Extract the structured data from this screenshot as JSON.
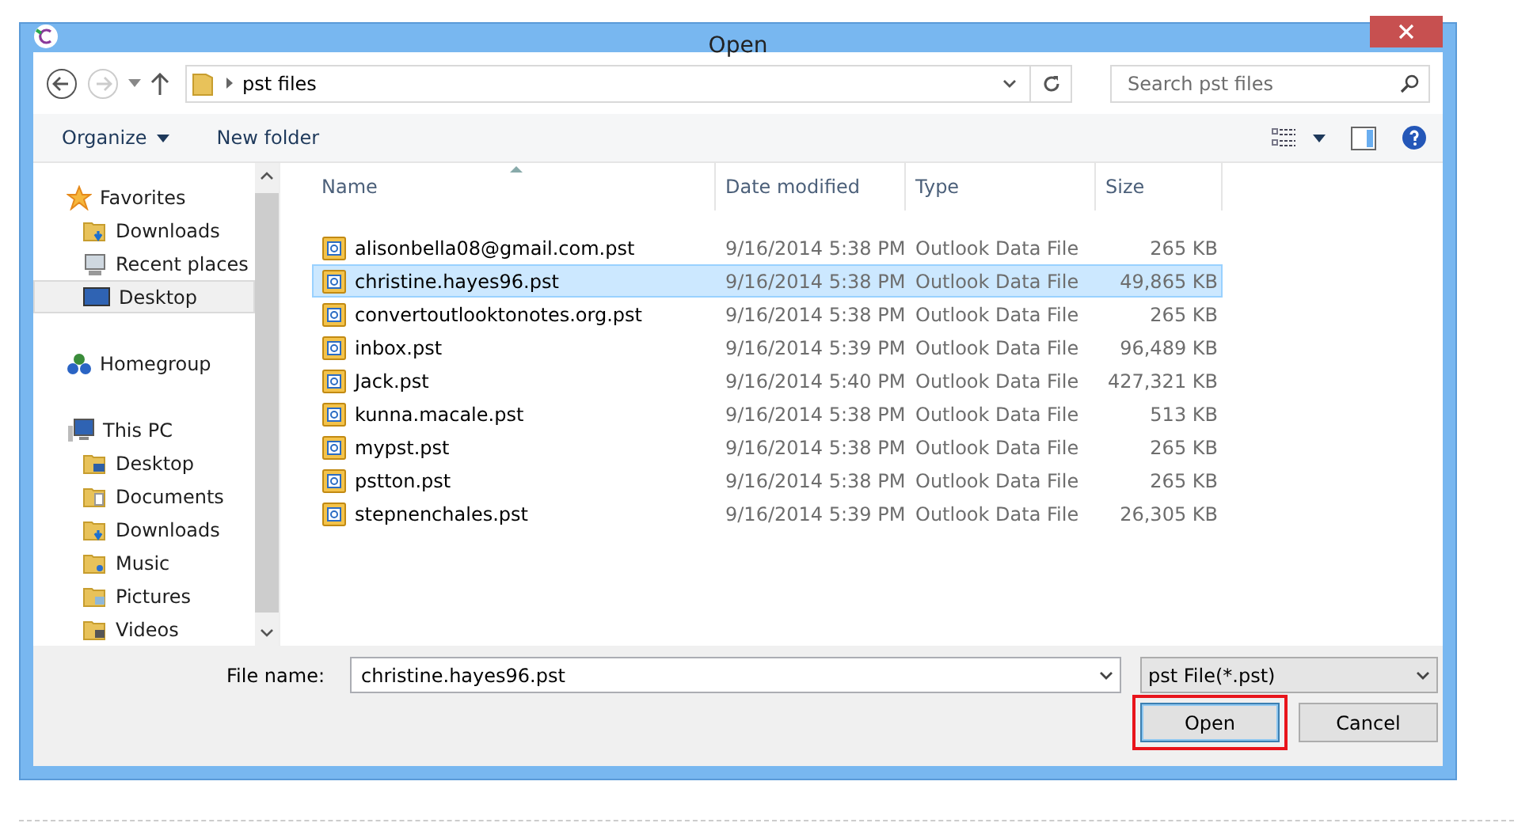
{
  "window": {
    "title": "Open"
  },
  "navigation": {
    "path": "pst files",
    "search": {
      "placeholder": "Search pst files"
    }
  },
  "toolbar": {
    "items": [
      "Organize",
      "New folder"
    ]
  },
  "sidebar": {
    "items": [
      {
        "label": "Favorites",
        "kind": "favorites",
        "selected": false,
        "children": [
          {
            "label": "Downloads",
            "kind": "downloads",
            "selected": false
          },
          {
            "label": "Recent places",
            "kind": "recent",
            "selected": false
          },
          {
            "label": "Desktop",
            "kind": "desktop",
            "selected": true
          }
        ]
      },
      {
        "label": "Homegroup",
        "kind": "homegroup",
        "selected": false
      },
      {
        "label": "This PC",
        "kind": "pc",
        "selected": false,
        "children": [
          {
            "label": "Desktop",
            "kind": "desktop-folder",
            "selected": false
          },
          {
            "label": "Documents",
            "kind": "documents",
            "selected": false
          },
          {
            "label": "Downloads",
            "kind": "downloads",
            "selected": false
          },
          {
            "label": "Music",
            "kind": "music",
            "selected": false
          },
          {
            "label": "Pictures",
            "kind": "pictures",
            "selected": false
          },
          {
            "label": "Videos",
            "kind": "videos",
            "selected": false
          }
        ]
      }
    ]
  },
  "table": {
    "columns": [
      "Name",
      "Date modified",
      "Type",
      "Size"
    ],
    "rows": [
      {
        "name": "alisonbella08@gmail.com.pst",
        "date": "9/16/2014 5:38 PM",
        "type": "Outlook Data File",
        "size": "265 KB",
        "selected": false
      },
      {
        "name": "christine.hayes96.pst",
        "date": "9/16/2014 5:38 PM",
        "type": "Outlook Data File",
        "size": "49,865 KB",
        "selected": true
      },
      {
        "name": "convertoutlooktonotes.org.pst",
        "date": "9/16/2014 5:38 PM",
        "type": "Outlook Data File",
        "size": "265 KB",
        "selected": false
      },
      {
        "name": "inbox.pst",
        "date": "9/16/2014 5:39 PM",
        "type": "Outlook Data File",
        "size": "96,489 KB",
        "selected": false
      },
      {
        "name": "Jack.pst",
        "date": "9/16/2014 5:40 PM",
        "type": "Outlook Data File",
        "size": "427,321 KB",
        "selected": false
      },
      {
        "name": "kunna.macale.pst",
        "date": "9/16/2014 5:38 PM",
        "type": "Outlook Data File",
        "size": "513 KB",
        "selected": false
      },
      {
        "name": "mypst.pst",
        "date": "9/16/2014 5:38 PM",
        "type": "Outlook Data File",
        "size": "265 KB",
        "selected": false
      },
      {
        "name": "pstton.pst",
        "date": "9/16/2014 5:38 PM",
        "type": "Outlook Data File",
        "size": "265 KB",
        "selected": false
      },
      {
        "name": "stepnenchales.pst",
        "date": "9/16/2014 5:39 PM",
        "type": "Outlook Data File",
        "size": "26,305 KB",
        "selected": false
      }
    ]
  },
  "footer": {
    "file_name_label": "File name:",
    "file_name": "christine.hayes96.pst",
    "file_type": "pst File(*.pst)",
    "buttons": [
      {
        "label": "Open",
        "highlighted": true
      },
      {
        "label": "Cancel",
        "highlighted": false
      }
    ]
  }
}
